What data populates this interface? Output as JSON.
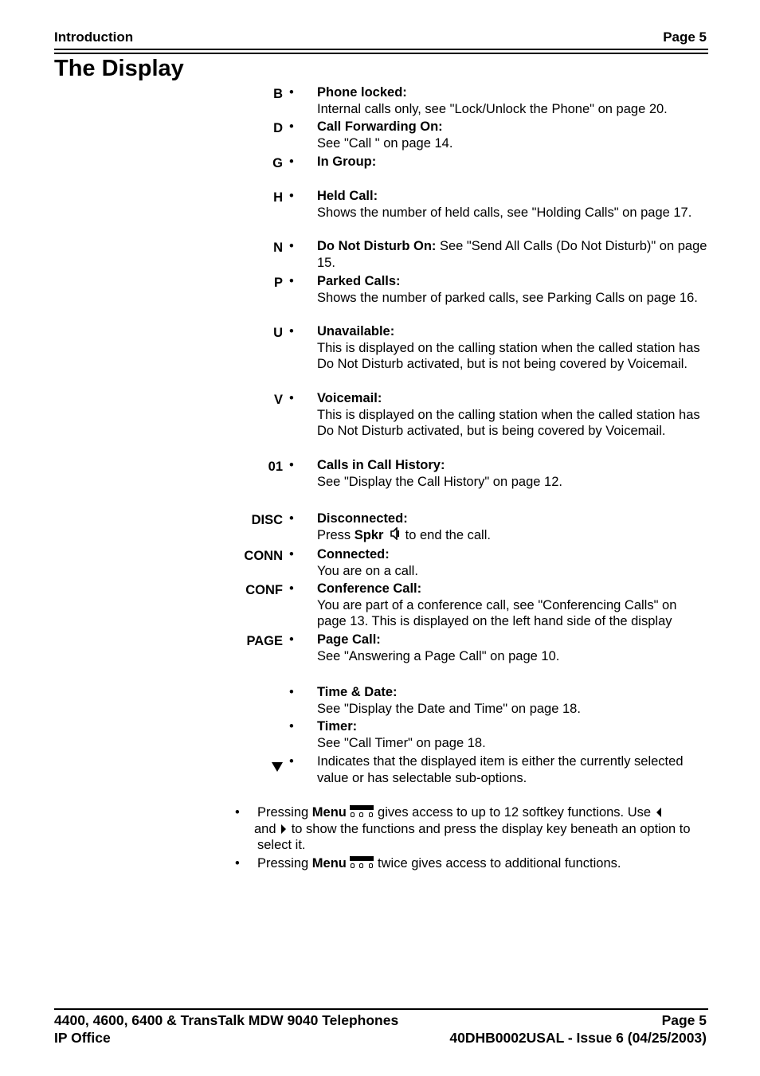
{
  "header": {
    "section": "Introduction",
    "page": "Page 5"
  },
  "title": "The Display",
  "entries": [
    {
      "code": "B",
      "label": "Phone locked:",
      "desc": "Internal calls only, see \"Lock/Unlock the Phone\" on page 20."
    },
    {
      "code": "D",
      "label": "Call Forwarding On:",
      "desc": "See \"Call \" on page 14."
    },
    {
      "code": "G",
      "label": "In Group:",
      "desc": ""
    },
    {
      "code": "H",
      "label": "Held Call:",
      "desc": "Shows the number of held calls, see \"Holding Calls\" on page 17."
    },
    {
      "code": "N",
      "label": "Do Not Disturb On:",
      "desc": " See \"Send All Calls (Do Not Disturb)\" on page 15."
    },
    {
      "code": "P",
      "label": "Parked Calls:",
      "desc": "Shows the number of parked calls, see Parking Calls on page 16."
    },
    {
      "code": "U",
      "label": "Unavailable:",
      "desc": "This is displayed on the calling station when the called station has Do Not Disturb activated, but is not being covered by Voicemail."
    },
    {
      "code": "V",
      "label": "Voicemail:",
      "desc": "This is displayed on the calling station when the called station has Do Not Disturb activated, but is being covered by Voicemail."
    },
    {
      "code": "01",
      "label": "Calls in Call History:",
      "desc": "See \"Display the Call History\" on page 12."
    },
    {
      "code": "DISC",
      "label": "Disconnected:",
      "desc_pre": "Press ",
      "desc_bold": "Spkr",
      "desc_icon": "speaker-icon",
      "desc_post": " to end the call."
    },
    {
      "code": "CONN",
      "label": "Connected:",
      "desc": "You are on a call."
    },
    {
      "code": "CONF",
      "label": "Conference Call:",
      "desc": "You are part of a conference call, see \"Conferencing Calls\" on page 13.  This is displayed on the left hand side of the display"
    },
    {
      "code": "PAGE",
      "label": "Page Call:",
      "desc": "See \"Answering a Page Call\" on page 10."
    },
    {
      "code": "",
      "label": "Time & Date:",
      "desc": "See \"Display the Date and Time\" on page 18."
    },
    {
      "code": "",
      "label": "Timer:",
      "desc": "See \"Call Timer\" on page 18."
    },
    {
      "code_icon": "down-triangle-icon",
      "label": "",
      "desc": "Indicates that the displayed item is either the currently selected value or has selectable sub-options."
    }
  ],
  "bullets": [
    {
      "pre": "Pressing ",
      "bold": "Menu",
      "mid": " gives access to up to 12 softkey functions. Use ",
      "and": " and ",
      "post": " to show the functions and press the display key beneath an option to select it."
    },
    {
      "pre": "Pressing ",
      "bold": "Menu",
      "post": " twice gives access to additional functions."
    }
  ],
  "bullet_char": "•",
  "footer": {
    "left1": "4400, 4600, 6400 & TransTalk MDW 9040 Telephones",
    "right1": "Page 5",
    "left2": "IP Office",
    "right2": "40DHB0002USAL - Issue 6 (04/25/2003)"
  }
}
